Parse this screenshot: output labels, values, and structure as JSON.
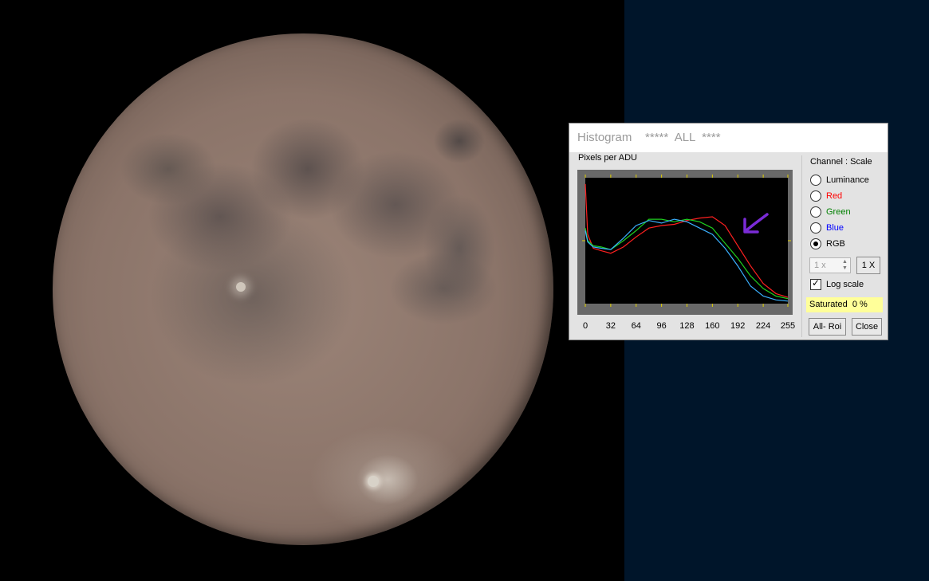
{
  "window": {
    "title": "Histogram    *****  ALL  ****"
  },
  "histogram": {
    "y_label": "Pixels per ADU",
    "x_ticks": [
      "0",
      "32",
      "64",
      "96",
      "128",
      "160",
      "192",
      "224",
      "255"
    ],
    "chart_data": {
      "type": "line",
      "xlim": [
        0,
        255
      ],
      "log_scale": true,
      "series": [
        {
          "name": "Red",
          "color": "#ff2020",
          "x": [
            0,
            3,
            10,
            20,
            32,
            48,
            64,
            80,
            96,
            112,
            128,
            144,
            160,
            176,
            192,
            208,
            224,
            240,
            255
          ],
          "y": [
            0.95,
            0.55,
            0.44,
            0.42,
            0.4,
            0.45,
            0.53,
            0.6,
            0.62,
            0.63,
            0.66,
            0.68,
            0.69,
            0.62,
            0.46,
            0.3,
            0.16,
            0.08,
            0.05
          ]
        },
        {
          "name": "Green",
          "color": "#1fd01f",
          "x": [
            0,
            3,
            10,
            20,
            32,
            48,
            64,
            80,
            96,
            112,
            128,
            144,
            160,
            176,
            192,
            208,
            224,
            240,
            255
          ],
          "y": [
            0.6,
            0.5,
            0.46,
            0.45,
            0.43,
            0.5,
            0.58,
            0.67,
            0.67,
            0.65,
            0.67,
            0.65,
            0.6,
            0.48,
            0.36,
            0.22,
            0.12,
            0.06,
            0.04
          ]
        },
        {
          "name": "Blue",
          "color": "#3ab0ff",
          "x": [
            0,
            3,
            10,
            20,
            32,
            48,
            64,
            80,
            96,
            112,
            128,
            144,
            160,
            176,
            192,
            208,
            224,
            240,
            255
          ],
          "y": [
            0.58,
            0.49,
            0.45,
            0.44,
            0.43,
            0.52,
            0.62,
            0.66,
            0.64,
            0.67,
            0.65,
            0.6,
            0.55,
            0.44,
            0.3,
            0.14,
            0.06,
            0.03,
            0.02
          ]
        }
      ]
    }
  },
  "channel": {
    "header": "Channel :  Scale",
    "options": [
      {
        "label": "Luminance",
        "color": "#000000",
        "checked": false
      },
      {
        "label": "Red",
        "color": "#ff0000",
        "checked": false
      },
      {
        "label": "Green",
        "color": "#008000",
        "checked": false
      },
      {
        "label": "Blue",
        "color": "#0000ff",
        "checked": false
      },
      {
        "label": "RGB",
        "color": "#000000",
        "checked": true
      }
    ]
  },
  "zoom": {
    "value": "1 x",
    "reset_label": "1 X"
  },
  "log_scale": {
    "label": "Log scale",
    "checked": true
  },
  "status": {
    "saturated": "Saturated  0 %"
  },
  "buttons": {
    "all_roi": "All- Roi",
    "close": "Close"
  },
  "annotation": {
    "arrow_color": "#7a2bd6"
  }
}
